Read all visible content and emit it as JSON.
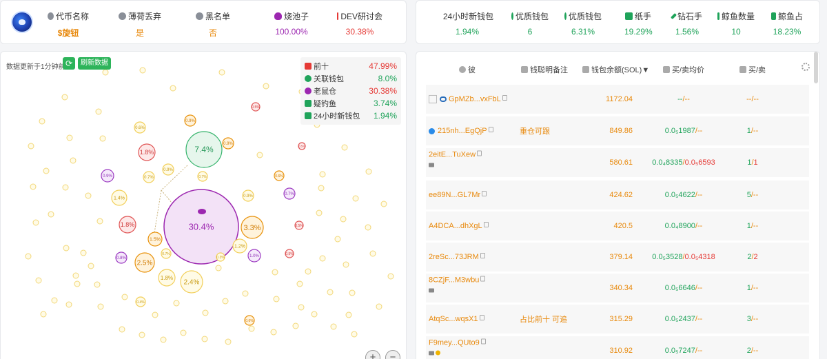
{
  "token": {
    "logo_icon": "token-logo-icon",
    "stats": [
      {
        "label": "代币名称",
        "icon": "coins-icon",
        "value": "$旋钮",
        "color": "#e8890c"
      },
      {
        "label": "薄荷丢弃",
        "icon": "user-icon",
        "value": "是",
        "color": "#e8890c"
      },
      {
        "label": "黑名单",
        "icon": "blacklist-user-icon",
        "value": "否",
        "color": "#e8890c"
      },
      {
        "label": "烧池子",
        "icon": "burn-pool-icon",
        "value": "100.00%",
        "color": "#9c27b0"
      },
      {
        "label": "DEV研讨会",
        "icon": "dev-icon",
        "value": "30.38%",
        "color": "#e53935"
      }
    ]
  },
  "wallet_stats": [
    {
      "label": "24小时新钱包",
      "icon": "wallet-icon",
      "value": "1.94%"
    },
    {
      "label": "优质钱包",
      "icon": "money-bag-icon",
      "value": "6"
    },
    {
      "label": "优质钱包",
      "icon": "money-bag-icon",
      "value": "6.31%"
    },
    {
      "label": "纸手",
      "icon": "paper-icon",
      "value": "19.29%"
    },
    {
      "label": "钻石手",
      "icon": "diamond-icon",
      "value": "1.56%"
    },
    {
      "label": "鲸鱼数量",
      "icon": "whale-icon",
      "value": "10"
    },
    {
      "label": "鲸鱼占",
      "icon": "whale-icon",
      "value": "18.23%"
    }
  ],
  "bubble_map": {
    "update_text": "数据更新于1分钟前",
    "refresh_label": "刷新数据",
    "legend": [
      {
        "label": "前十",
        "value": "47.99%",
        "icon": "top-ten-icon",
        "color": "#e53935"
      },
      {
        "label": "关联钱包",
        "value": "8.0%",
        "icon": "link-icon",
        "color": "#1fa35a"
      },
      {
        "label": "老鼠仓",
        "value": "30.38%",
        "icon": "rat-icon",
        "color": "#e53935"
      },
      {
        "label": "疑钓鱼",
        "value": "3.74%",
        "icon": "fishing-icon",
        "color": "#1fa35a"
      },
      {
        "label": "24小时新钱包",
        "value": "1.94%",
        "icon": "new-wallet-icon",
        "color": "#1fa35a"
      }
    ],
    "bubbles": [
      {
        "label": "30.4%",
        "kind": "purple-big"
      },
      {
        "label": "7.4%",
        "kind": "green"
      },
      {
        "label": "3.3%",
        "kind": "orange"
      },
      {
        "label": "2.5%",
        "kind": "orange"
      },
      {
        "label": "2.4%",
        "kind": "yellow"
      },
      {
        "label": "1.8%",
        "kind": "red"
      },
      {
        "label": "1.8%",
        "kind": "red"
      },
      {
        "label": "1.8%",
        "kind": "yellow"
      },
      {
        "label": "1.5%",
        "kind": "orange"
      },
      {
        "label": "1.4%",
        "kind": "yellow"
      },
      {
        "label": "1.2%",
        "kind": "yellow"
      },
      {
        "label": "1.0%",
        "kind": "purple"
      },
      {
        "label": "0.9%",
        "kind": "purple"
      },
      {
        "label": "0.8%",
        "kind": "purple"
      },
      {
        "label": "0.7%",
        "kind": "purple"
      },
      {
        "label": "0.9%",
        "kind": "yellow"
      },
      {
        "label": "0.9%",
        "kind": "orange"
      },
      {
        "label": "0.9%",
        "kind": "orange"
      },
      {
        "label": "0.9%",
        "kind": "yellow"
      },
      {
        "label": "0.7%",
        "kind": "yellow"
      },
      {
        "label": "0.7%",
        "kind": "yellow"
      },
      {
        "label": "0.7%",
        "kind": "yellow"
      },
      {
        "label": "0.6%",
        "kind": "yellow"
      },
      {
        "label": "0.6%",
        "kind": "orange"
      },
      {
        "label": "0.6%",
        "kind": "orange"
      },
      {
        "label": "0.5%",
        "kind": "red"
      },
      {
        "label": "0.5%",
        "kind": "red"
      },
      {
        "label": "0.5%",
        "kind": "red"
      },
      {
        "label": "0.5%",
        "kind": "red"
      },
      {
        "label": "0.4%",
        "kind": "yellow"
      },
      {
        "label": "0.3%",
        "kind": "yellow"
      }
    ],
    "zoom_in_label": "+",
    "zoom_out_label": "−"
  },
  "holders_table": {
    "headers": [
      {
        "label": "彼",
        "icon": "user-icon"
      },
      {
        "label": "钱聪明备注",
        "icon": "note-icon"
      },
      {
        "label": "钱包余额(SOL)▼",
        "icon": "wallet-icon"
      },
      {
        "label": "买/卖均价",
        "icon": "price-icon"
      },
      {
        "label": "买/卖",
        "icon": "trade-icon"
      }
    ],
    "rows": [
      {
        "address": "GpMZb...vxFbL",
        "note": "",
        "balance": "1172.04",
        "avg_buy": "--",
        "avg_sep": "/",
        "avg_sell": "--",
        "buys": "--",
        "trade_sep": "/",
        "sells": "--"
      },
      {
        "address": "215nh...EgQjP",
        "note": "重仓可跟",
        "balance": "849.86",
        "avg_buy": "0.0₅1987",
        "avg_sep": "/",
        "avg_sell": "--",
        "buys": "1",
        "trade_sep": "/",
        "sells": "--"
      },
      {
        "address": "2eitE...TuXew",
        "note": "",
        "balance": "580.61",
        "avg_buy": "0.0₄8335",
        "avg_sep": "/",
        "avg_sell": "0.0₅6593",
        "buys": "1",
        "trade_sep": "/",
        "sells": "1"
      },
      {
        "address": "ee89N...GL7Mr",
        "note": "",
        "balance": "424.62",
        "avg_buy": "0.0₅4622",
        "avg_sep": "/",
        "avg_sell": "--",
        "buys": "5",
        "trade_sep": "/",
        "sells": "--"
      },
      {
        "address": "A4DCA...dhXgL",
        "note": "",
        "balance": "420.5",
        "avg_buy": "0.0₄8900",
        "avg_sep": "/",
        "avg_sell": "--",
        "buys": "1",
        "trade_sep": "/",
        "sells": "--"
      },
      {
        "address": "2reSc...73JRM",
        "note": "",
        "balance": "379.14",
        "avg_buy": "0.0₅3528",
        "avg_sep": "/",
        "avg_sell": "0.0₅4318",
        "buys": "2",
        "trade_sep": "/",
        "sells": "2"
      },
      {
        "address": "8CZjF...M3wbu",
        "note": "",
        "balance": "340.34",
        "avg_buy": "0.0₅6646",
        "avg_sep": "/",
        "avg_sell": "--",
        "buys": "1",
        "trade_sep": "/",
        "sells": "--"
      },
      {
        "address": "AtqSc...wqsX1",
        "note": "占比前十 可追",
        "balance": "315.29",
        "avg_buy": "0.0₅2437",
        "avg_sep": "/",
        "avg_sell": "--",
        "buys": "3",
        "trade_sep": "/",
        "sells": "--"
      },
      {
        "address": "F9mey...QUto9",
        "note": "",
        "balance": "310.92",
        "avg_buy": "0.0₅7247",
        "avg_sep": "/",
        "avg_sell": "--",
        "buys": "2",
        "trade_sep": "/",
        "sells": "--"
      }
    ]
  }
}
